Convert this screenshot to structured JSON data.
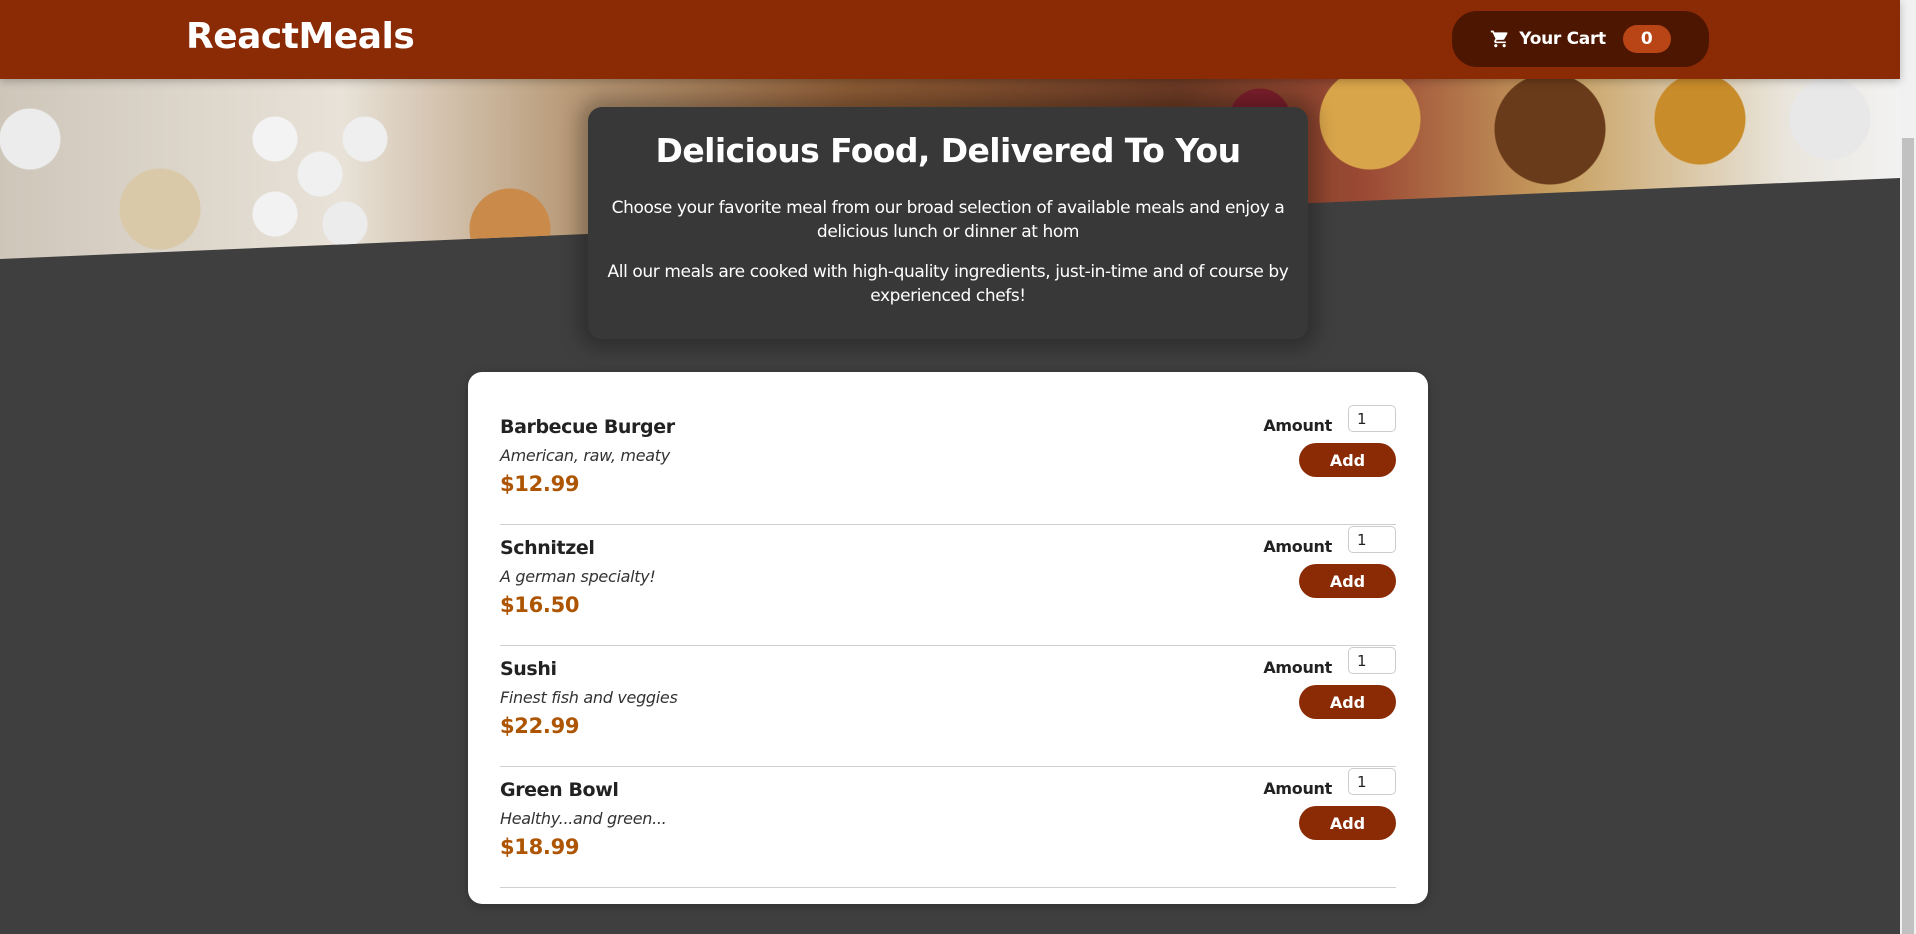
{
  "header": {
    "logo": "ReactMeals",
    "cart_label": "Your Cart",
    "cart_count": "0",
    "cart_icon": "cart-icon"
  },
  "summary": {
    "title": "Delicious Food, Delivered To You",
    "p1": "Choose your favorite meal from our broad selection of available meals and enjoy a delicious lunch or dinner at hom",
    "p2": "All our meals are cooked with high-quality ingredients, just-in-time and of course by experienced chefs!"
  },
  "meals": [
    {
      "name": "Barbecue Burger",
      "description": "American, raw, meaty",
      "price": "$12.99",
      "amount_label": "Amount",
      "amount": "1",
      "add_label": "Add"
    },
    {
      "name": "Schnitzel",
      "description": "A german specialty!",
      "price": "$16.50",
      "amount_label": "Amount",
      "amount": "1",
      "add_label": "Add"
    },
    {
      "name": "Sushi",
      "description": "Finest fish and veggies",
      "price": "$22.99",
      "amount_label": "Amount",
      "amount": "1",
      "add_label": "Add"
    },
    {
      "name": "Green Bowl",
      "description": "Healthy...and green...",
      "price": "$18.99",
      "amount_label": "Amount",
      "amount": "1",
      "add_label": "Add"
    }
  ],
  "colors": {
    "header": "#8a2b06",
    "cart_button": "#4d1601",
    "badge": "#b94517",
    "price": "#ad5502",
    "background": "#3f3f3f",
    "summary_card": "#383838"
  }
}
